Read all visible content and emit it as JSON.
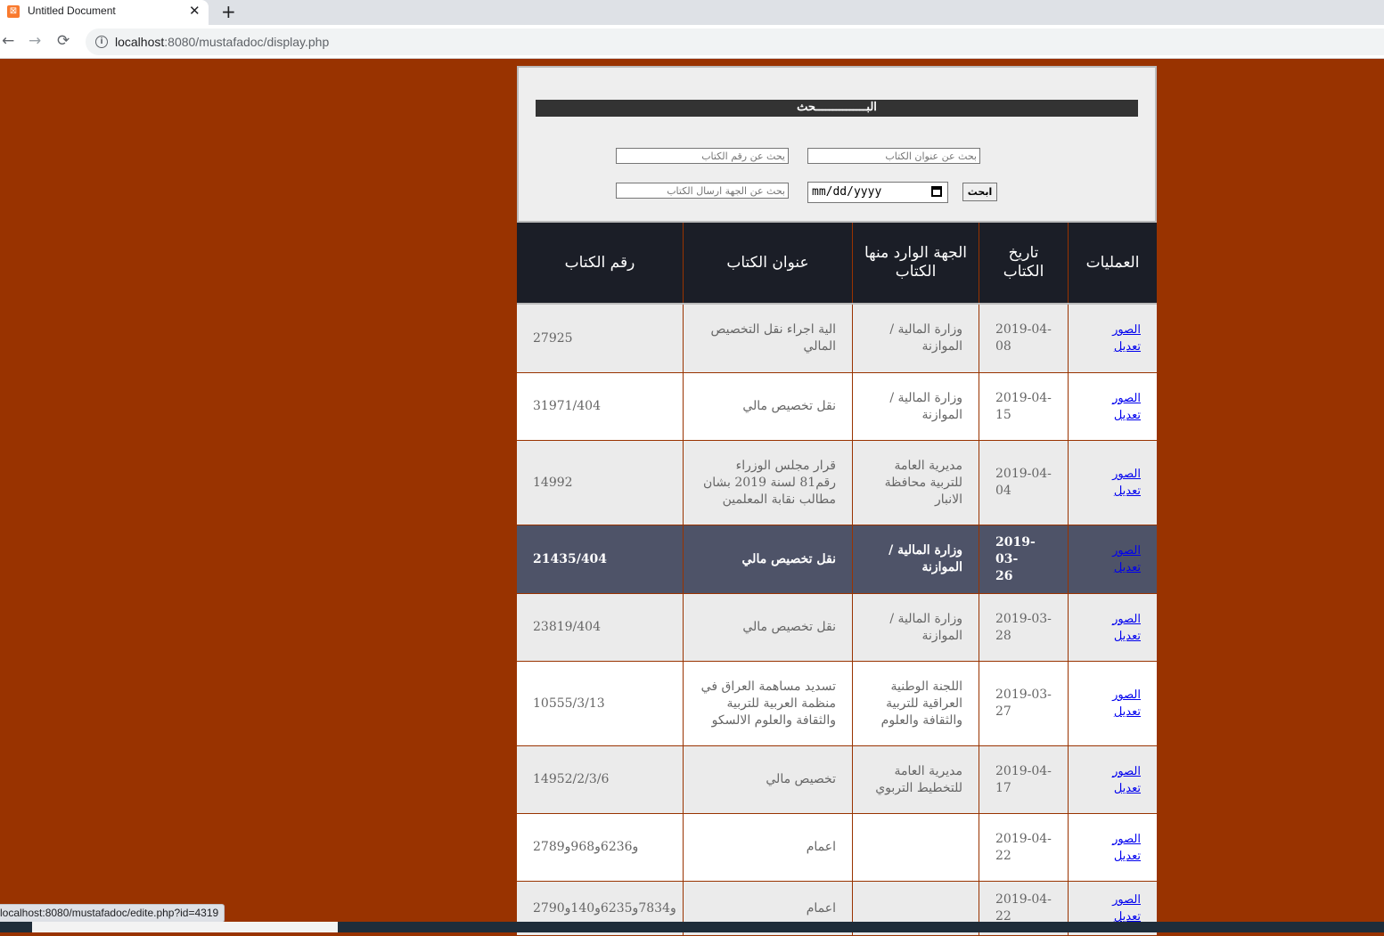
{
  "browser": {
    "tab_title": "Untitled Document",
    "tab_close": "✕",
    "new_tab": "+",
    "back": "←",
    "forward": "→",
    "reload": "⟳",
    "url_host": "localhost",
    "url_rest": ":8080/mustafadoc/display.php",
    "status_url": "localhost:8080/mustafadoc/edite.php?id=4319"
  },
  "search": {
    "title": "البـــــــــــــــحث",
    "by_number_placeholder": "يحث عن رقم الكتاب",
    "by_title_placeholder": "بحث عن عنوان الكتاب",
    "by_sender_placeholder": "بحث عن الجهة ارسال الكتاب",
    "date_value": "mm/dd/yyyy",
    "button_label": "ابحث"
  },
  "table": {
    "headers": {
      "ops": "العمليات",
      "date": "تاريخ الكتاب",
      "source": "الجهة الوارد منها الكتاب",
      "title": "عنوان الكتاب",
      "number": "رقم الكتاب"
    },
    "link_images": "الصور",
    "link_edit": "تعديل",
    "rows": [
      {
        "d1": "2019-04-",
        "d2": "08",
        "source": "وزارة المالية / الموازنة",
        "title": "الية اجراء نقل التخصيص المالي",
        "number": "27925"
      },
      {
        "d1": "2019-04-",
        "d2": "15",
        "source": "وزارة المالية / الموازنة",
        "title": "نقل تخصيص مالي",
        "number": "31971/404"
      },
      {
        "d1": "2019-04-",
        "d2": "04",
        "source": "مديرية العامة للتربية محافظة الانبار",
        "title": "قرار مجلس الوزراء رقم81 لسنة 2019 بشان مطالب نقابة المعلمين",
        "number": "14992"
      },
      {
        "d1": "2019-03-",
        "d2": "26",
        "source": "وزارة المالية / الموازنة",
        "title": "نقل تخصيص مالي",
        "number": "21435/404"
      },
      {
        "d1": "2019-03-",
        "d2": "28",
        "source": "وزارة المالية / الموازنة",
        "title": "نقل تخصيص مالي",
        "number": "23819/404"
      },
      {
        "d1": "2019-03-",
        "d2": "27",
        "source": "اللجنة الوطنية العراقية للتربية والثقافة والعلوم",
        "title": "تسديد مساهمة العراق في منظمة العربية للتربية والثقافة والعلوم الالسكو",
        "number": "10555/3/13"
      },
      {
        "d1": "2019-04-",
        "d2": "17",
        "source": "مديرية العامة للتخطيط التربوي",
        "title": "تخصيص مالي",
        "number": "14952/2/3/6"
      },
      {
        "d1": "2019-04-",
        "d2": "22",
        "source": "",
        "title": "اعمام",
        "number": "و6236و968و2789"
      },
      {
        "d1": "2019-04-",
        "d2": "22",
        "source": "",
        "title": "اعمام",
        "number": "و7834و6235و140و2790"
      }
    ]
  }
}
